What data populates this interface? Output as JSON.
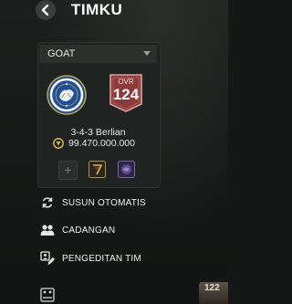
{
  "header": {
    "title": "TIMKU"
  },
  "squad_selector": {
    "selected": "GOAT"
  },
  "team": {
    "ovr_label": "OVR",
    "ovr_value": "124",
    "formation": "3-4-3 Berlian",
    "value": "99.470.000.000"
  },
  "menu": {
    "auto_arrange": "SUSUN OTOMATIS",
    "substitutes": "CADANGAN",
    "team_editing": "PENGEDITAN TIM"
  },
  "partial_card": {
    "ovr_value": "122"
  },
  "colors": {
    "background": "#141715",
    "panel": "#1f2321",
    "badge_red": "#8e3a3a",
    "coin_gold": "#d8b24a",
    "club_blue": "#1d4fa0"
  }
}
